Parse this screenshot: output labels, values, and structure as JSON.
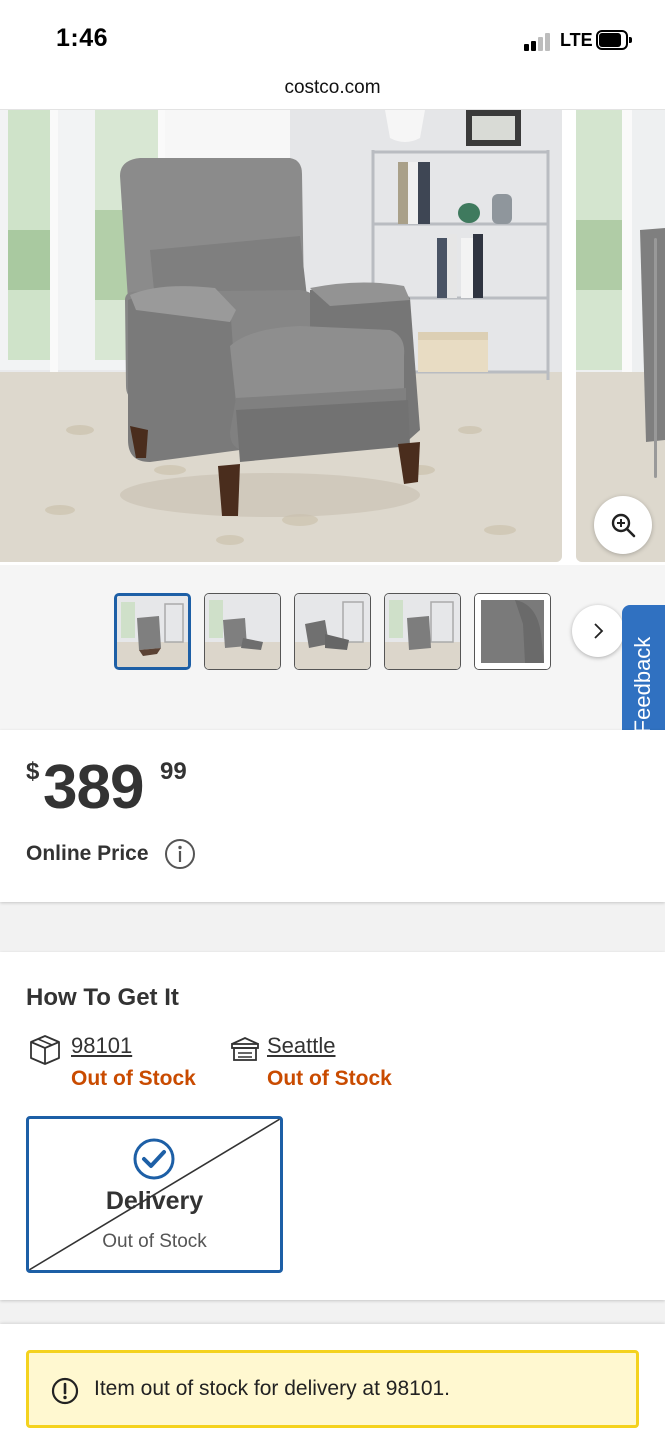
{
  "status_bar": {
    "time": "1:46",
    "network": "LTE"
  },
  "browser": {
    "url": "costco.com"
  },
  "gallery": {
    "zoom_icon": "zoom-in-icon",
    "next_icon": "chevron-right-icon",
    "thumbnail_count": 5
  },
  "feedback": {
    "label": "Feedback"
  },
  "price": {
    "currency": "$",
    "dollars": "389",
    "cents": "99",
    "label": "Online Price"
  },
  "how_to_get": {
    "title": "How To Get It",
    "shipping": {
      "icon": "package-icon",
      "location": "98101",
      "status": "Out of Stock"
    },
    "warehouse": {
      "icon": "store-icon",
      "location": "Seattle",
      "status": "Out of Stock"
    },
    "delivery": {
      "title": "Delivery",
      "status": "Out of Stock"
    }
  },
  "alert": {
    "message": "Item out of stock for delivery at 98101."
  },
  "colors": {
    "accent_blue": "#1d5fa6",
    "out_of_stock": "#c94b00",
    "alert_bg": "#fff8d0",
    "alert_border": "#f4d21e",
    "feedback_bg": "#3071c1"
  }
}
